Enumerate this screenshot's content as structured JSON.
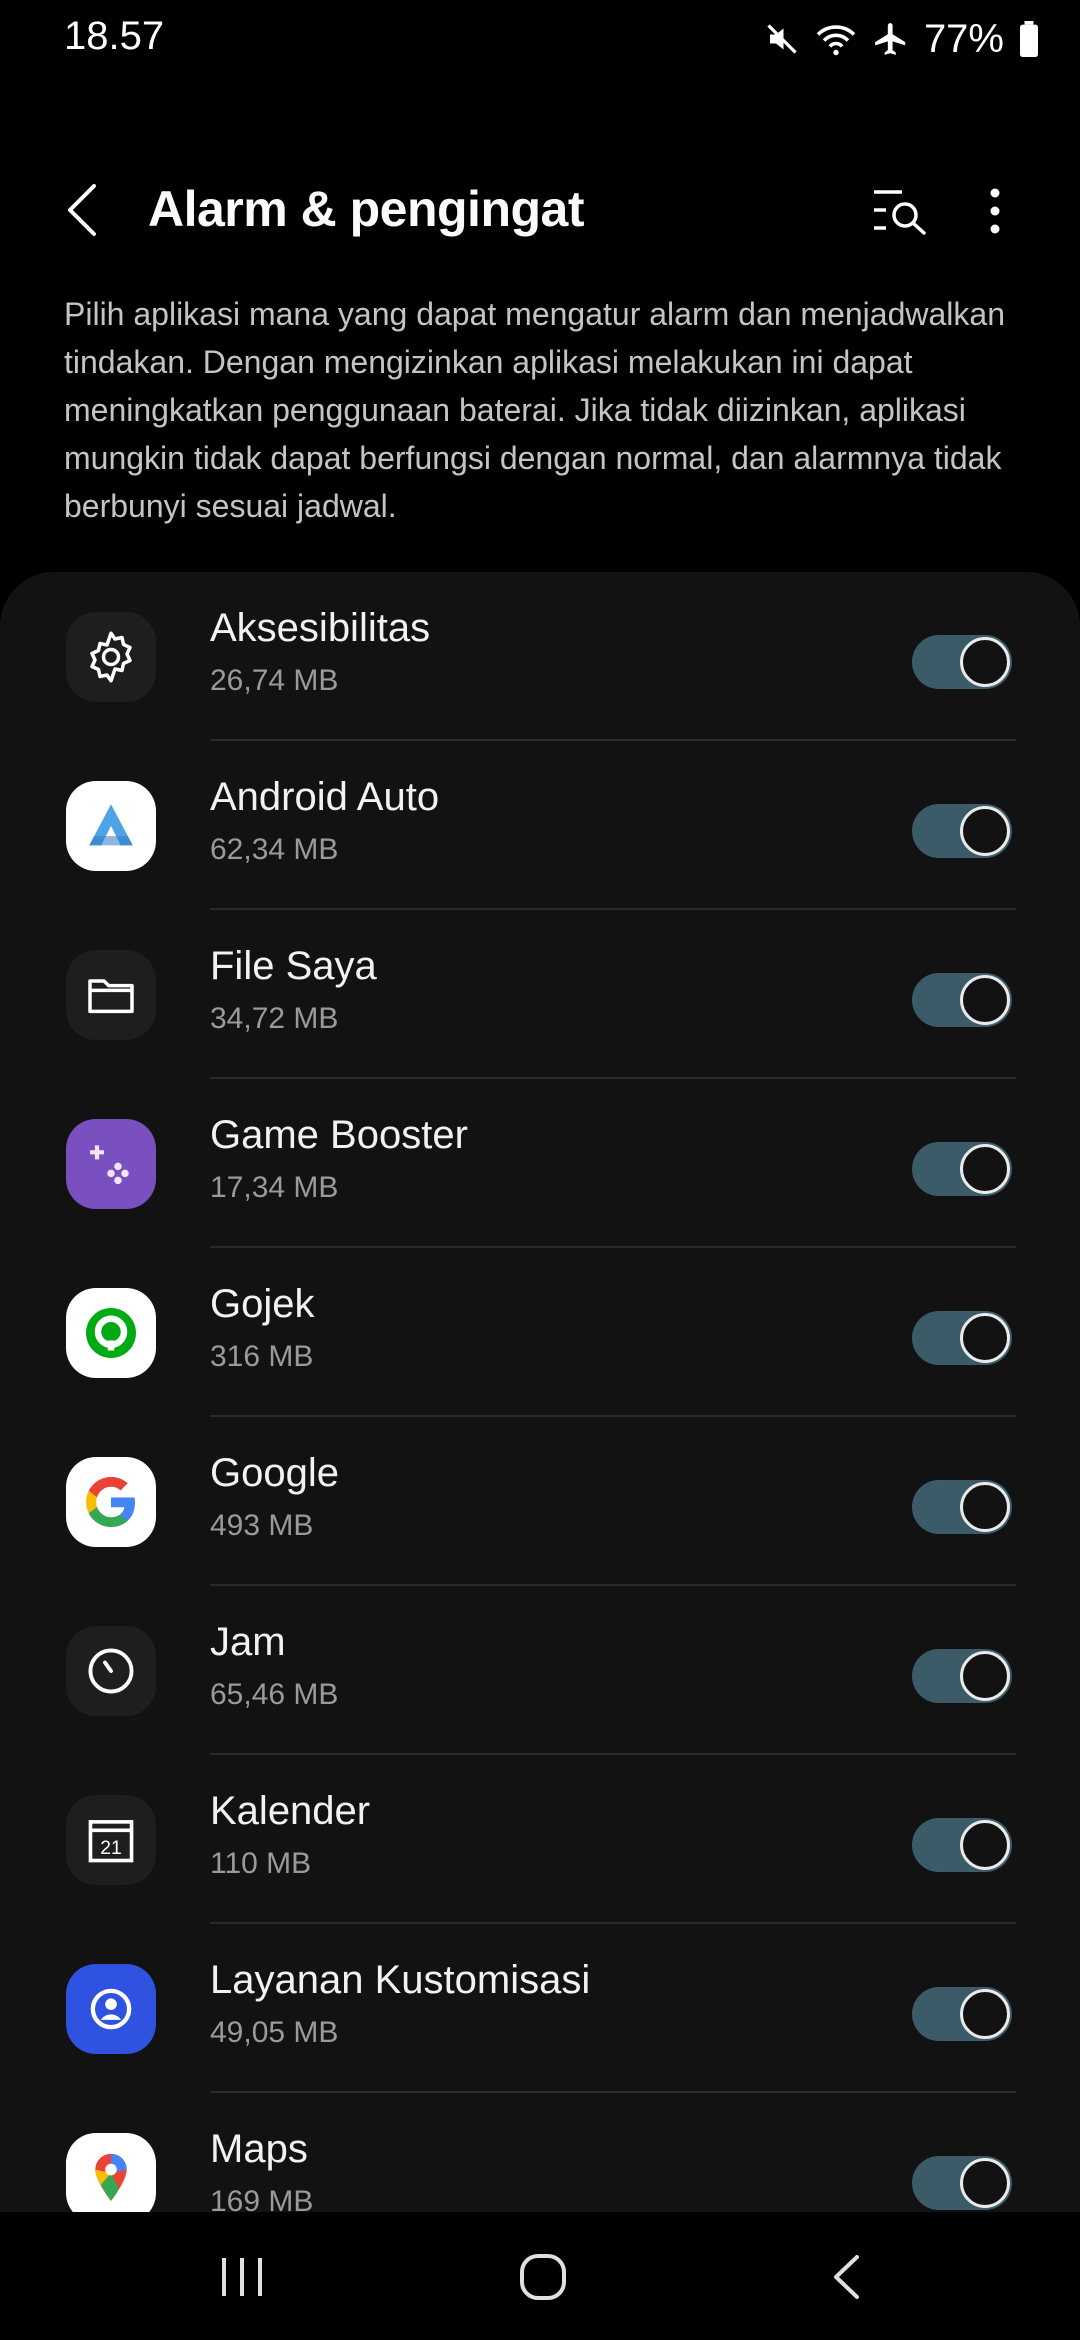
{
  "status_bar": {
    "time": "18.57",
    "battery": "77%"
  },
  "header": {
    "title": "Alarm & pengingat"
  },
  "description": "Pilih aplikasi mana yang dapat mengatur alarm dan menjadwalkan tindakan. Dengan mengizinkan aplikasi melakukan ini dapat meningkatkan penggunaan baterai. Jika tidak diizinkan, aplikasi mungkin tidak dapat berfungsi dengan normal, dan alarmnya tidak berbunyi sesuai jadwal.",
  "apps": [
    {
      "name": "Aksesibilitas",
      "size": "26,74 MB",
      "icon": "accessibility-gear-icon",
      "enabled": true
    },
    {
      "name": "Android Auto",
      "size": "62,34 MB",
      "icon": "android-auto-icon",
      "enabled": true
    },
    {
      "name": "File Saya",
      "size": "34,72 MB",
      "icon": "folder-icon",
      "enabled": true
    },
    {
      "name": "Game Booster",
      "size": "17,34 MB",
      "icon": "game-booster-icon",
      "enabled": true
    },
    {
      "name": "Gojek",
      "size": "316 MB",
      "icon": "gojek-icon",
      "enabled": true
    },
    {
      "name": "Google",
      "size": "493 MB",
      "icon": "google-icon",
      "enabled": true
    },
    {
      "name": "Jam",
      "size": "65,46 MB",
      "icon": "clock-icon",
      "enabled": true
    },
    {
      "name": "Kalender",
      "size": "110 MB",
      "icon": "calendar-icon",
      "enabled": true
    },
    {
      "name": "Layanan Kustomisasi",
      "size": "49,05 MB",
      "icon": "customization-service-icon",
      "enabled": true
    },
    {
      "name": "Maps",
      "size": "169 MB",
      "icon": "maps-icon",
      "enabled": true
    }
  ],
  "calendar_icon_day": "21",
  "colors": {
    "background": "#000000",
    "card": "#121212",
    "toggle_track": "#3c5b68",
    "text_secondary": "#9a9a9a"
  }
}
